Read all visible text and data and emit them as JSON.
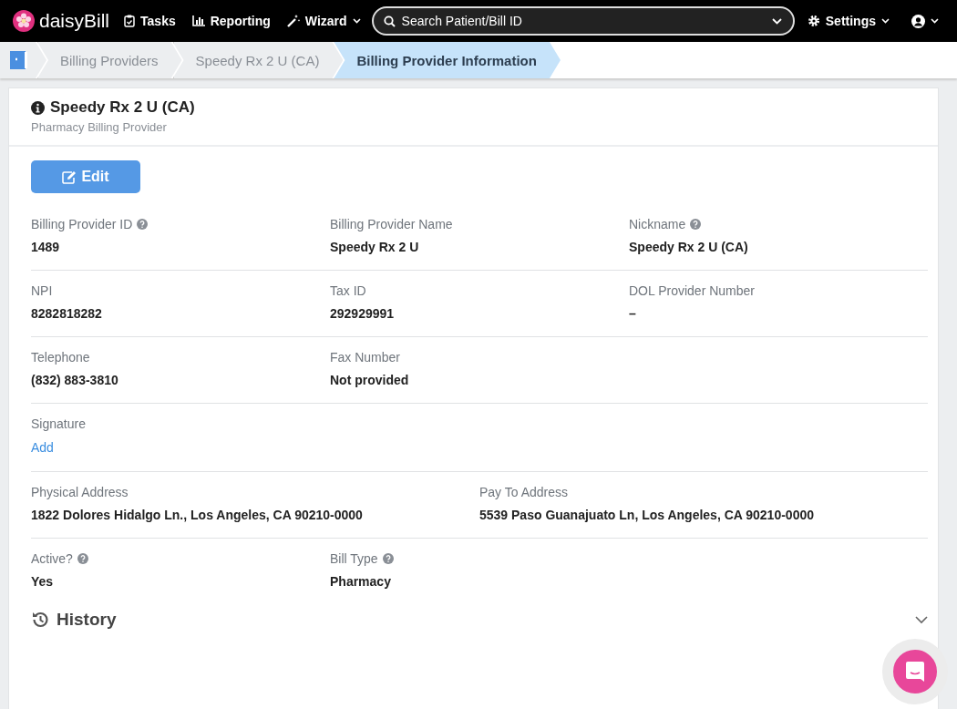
{
  "topbar": {
    "logo": "daisy**Bill**",
    "nav": [
      {
        "label": "Tasks",
        "dropdown": false
      },
      {
        "label": "Reporting",
        "dropdown": false
      },
      {
        "label": "Wizard",
        "dropdown": true
      }
    ],
    "search": {
      "placeholder": "Search Patient/Bill ID"
    },
    "settings": {
      "label": "Settings"
    }
  },
  "breadcrumbs": [
    {
      "label": "Billing Providers",
      "selected": false
    },
    {
      "label": "Speedy Rx 2 U (CA)",
      "selected": false
    },
    {
      "label": "Billing Provider Information",
      "selected": true
    }
  ],
  "card": {
    "title": "Speedy Rx 2 U (CA)",
    "subtitle": "Pharmacy Billing Provider",
    "edit_button": "Edit",
    "rows": [
      {
        "kind": "thirds",
        "fields": [
          {
            "label": "Billing Provider ID",
            "help": true,
            "value": "1489",
            "kind": "text"
          },
          {
            "label": "Billing Provider Name",
            "help": false,
            "value": "Speedy Rx 2 U",
            "kind": "text"
          },
          {
            "label": "Nickname",
            "help": true,
            "value": "Speedy Rx 2 U (CA)",
            "kind": "text"
          }
        ]
      },
      {
        "kind": "thirds",
        "fields": [
          {
            "label": "NPI",
            "help": false,
            "value": "8282818282",
            "kind": "text"
          },
          {
            "label": "Tax ID",
            "help": false,
            "value": "292929991",
            "kind": "text"
          },
          {
            "label": "DOL Provider Number",
            "help": false,
            "value": "–",
            "kind": "text"
          }
        ]
      },
      {
        "kind": "thirds",
        "fields": [
          {
            "label": "Telephone",
            "help": false,
            "value": "(832) 883-3810",
            "kind": "text"
          },
          {
            "label": "Fax Number",
            "help": false,
            "value": "Not provided",
            "kind": "text"
          }
        ]
      },
      {
        "kind": "thirds",
        "fields": [
          {
            "label": "Signature",
            "help": false,
            "value": "Add",
            "kind": "link"
          }
        ]
      },
      {
        "kind": "halves",
        "fields": [
          {
            "label": "Physical Address",
            "help": false,
            "value": "1822 Dolores Hidalgo Ln., Los Angeles, CA 90210-0000",
            "kind": "text"
          },
          {
            "label": "Pay To Address",
            "help": false,
            "value": "5539 Paso Guanajuato Ln, Los Angeles, CA 90210-0000",
            "kind": "text"
          }
        ]
      },
      {
        "kind": "thirds",
        "fields": [
          {
            "label": "Active?",
            "help": true,
            "value": "Yes",
            "kind": "text"
          },
          {
            "label": "Bill Type",
            "help": true,
            "value": "Pharmacy",
            "kind": "text"
          }
        ]
      }
    ],
    "history": {
      "title": "History",
      "expanded": false
    }
  }
}
